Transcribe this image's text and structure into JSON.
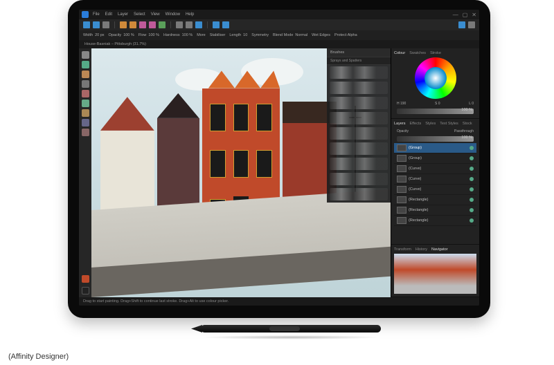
{
  "app": {
    "name": "Affinity Designer"
  },
  "menu": [
    "File",
    "Edit",
    "Layer",
    "Select",
    "View",
    "Window",
    "Help"
  ],
  "window_controls": {
    "min": "—",
    "max": "▢",
    "close": "✕"
  },
  "options": {
    "width_label": "Width",
    "width_val": "20 px",
    "opacity_label": "Opacity",
    "opacity_val": "100 %",
    "flow_label": "Flow",
    "flow_val": "100 %",
    "hardness_label": "Hardness",
    "hardness_val": "100 %",
    "more_label": "More",
    "stabiliser_label": "Stabiliser",
    "length_label": "Length",
    "length_val": "10",
    "symmetry_label": "Symmetry",
    "blend_label": "Blend Mode",
    "blend_val": "Normal",
    "wet_label": "Wet Edges",
    "protect_label": "Protect Alpha"
  },
  "document": {
    "name": "House-Basniak – Pittsburgh",
    "zoom": "(31.7%)"
  },
  "brushes": {
    "panel": "Brushes",
    "category": "Sprays and Spatters"
  },
  "colour_panel": {
    "tabs": [
      "Colour",
      "Swatches",
      "Stroke"
    ],
    "h": "H 190",
    "s": "S 0",
    "l": "L 0",
    "opacity_label": "Opacity",
    "opacity_val": "100 %"
  },
  "layers_panel": {
    "tabs": [
      "Layers",
      "Effects",
      "Styles",
      "Text Styles",
      "Stock"
    ],
    "opacity_label": "Opacity",
    "opacity_val": "100 %",
    "items": [
      {
        "name": "(Group)",
        "sel": true
      },
      {
        "name": "(Group)"
      },
      {
        "name": "(Curve)"
      },
      {
        "name": "(Curve)"
      },
      {
        "name": "(Curve)"
      },
      {
        "name": "(Rectangle)"
      },
      {
        "name": "(Rectangle)"
      },
      {
        "name": "(Rectangle)"
      }
    ],
    "passthrough": "Passthrough"
  },
  "nav_panel": {
    "tabs": [
      "Transform",
      "History",
      "Navigator"
    ]
  },
  "statusbar": {
    "hint": "Drag to start painting. Drag+Shift to continue last stroke. Drag+Alt to use colour picker."
  },
  "caption": "(Affinity Designer)"
}
